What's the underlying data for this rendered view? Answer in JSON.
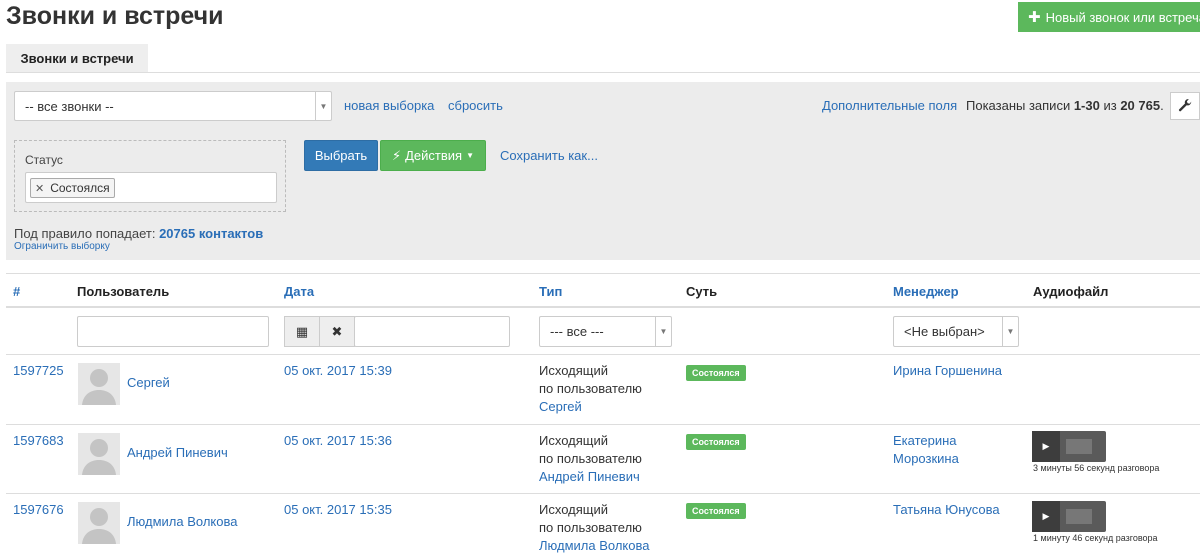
{
  "header": {
    "title": "Звонки и встречи",
    "new_button_label": "Новый звонок или встреча"
  },
  "tabs": [
    {
      "label": "Звонки и встречи"
    }
  ],
  "filters": {
    "preset_value": "-- все звонки --",
    "new_selection": "новая выборка",
    "reset": "сбросить",
    "extra_fields": "Дополнительные поля",
    "records_prefix": "Показаны записи ",
    "records_range": "1-30",
    "records_middle": " из ",
    "records_total": "20 765",
    "records_suffix": ".",
    "status_label": "Статус",
    "status_tag": "Состоялся",
    "select_button": "Выбрать",
    "actions_button": "Действия",
    "save_as": "Сохранить как...",
    "rule_prefix": "Под правило попадает: ",
    "rule_count": "20765 контактов",
    "limit_link": "Ограничить выборку"
  },
  "table": {
    "columns": [
      "#",
      "Пользователь",
      "Дата",
      "Тип",
      "Суть",
      "Менеджер",
      "Аудиофайл"
    ],
    "type_filter": "--- все ---",
    "manager_filter": "<Не выбран>",
    "rows": [
      {
        "id": "1597725",
        "user": "Сергей",
        "date": "05 окт. 2017 15:39",
        "type_line1": "Исходящий",
        "type_line2": "по пользователю",
        "type_user": "Сергей",
        "status": "Состоялся",
        "manager_line1": "Ирина Горшенина",
        "manager_line2": "",
        "audio_text": ""
      },
      {
        "id": "1597683",
        "user": "Андрей Пиневич",
        "date": "05 окт. 2017 15:36",
        "type_line1": "Исходящий",
        "type_line2": "по пользователю",
        "type_user": "Андрей Пиневич",
        "status": "Состоялся",
        "manager_line1": "Екатерина",
        "manager_line2": "Морозкина",
        "audio_text": "3 минуты 56 секунд разговора"
      },
      {
        "id": "1597676",
        "user": "Людмила Волкова",
        "date": "05 окт. 2017 15:35",
        "type_line1": "Исходящий",
        "type_line2": "по пользователю",
        "type_user": "Людмила Волкова",
        "status": "Состоялся",
        "manager_line1": "Татьяна Юнусова",
        "manager_line2": "",
        "audio_text": "1 минуту 46 секунд разговора"
      }
    ]
  },
  "colors": {
    "accent_green": "#5cb85c",
    "accent_blue": "#337ab7",
    "link": "#2a6eb7"
  }
}
